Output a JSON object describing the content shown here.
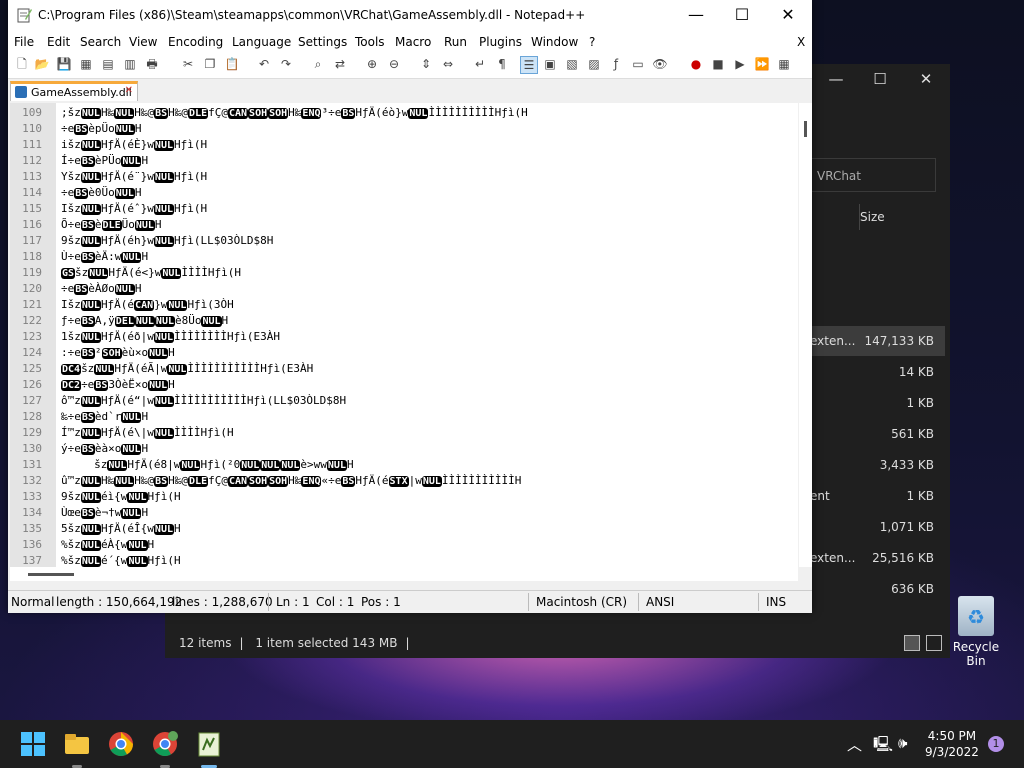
{
  "explorer": {
    "search_placeholder": "VRChat",
    "size_header": "Size",
    "rows": [
      {
        "name": "exten...",
        "size": "147,133 KB",
        "selected": true
      },
      {
        "name": "",
        "size": "14 KB"
      },
      {
        "name": "",
        "size": "1 KB"
      },
      {
        "name": "",
        "size": "561 KB"
      },
      {
        "name": "",
        "size": "3,433 KB"
      },
      {
        "name": "ent",
        "size": "1 KB"
      },
      {
        "name": "",
        "size": "1,071 KB"
      },
      {
        "name": "exten...",
        "size": "25,516 KB"
      },
      {
        "name": "",
        "size": "636 KB"
      }
    ],
    "status": {
      "items": "12 items",
      "selected": "1 item selected  143 MB"
    }
  },
  "npp": {
    "title": "C:\\Program Files (x86)\\Steam\\steamapps\\common\\VRChat\\GameAssembly.dll - Notepad++",
    "menu": [
      "File",
      "Edit",
      "Search",
      "View",
      "Encoding",
      "Language",
      "Settings",
      "Tools",
      "Macro",
      "Run",
      "Plugins",
      "Window",
      "?"
    ],
    "menu_close": "X",
    "tab_label": "GameAssembly.dll",
    "lines": [
      {
        "n": "109",
        "t": ";šz␀H‰␀H‰@␈H‰@␐fÇ@␘␁␁H‰␅³÷e␈HƒÄ(éò}w␀ÌÌÌÌÌÌÌÌÌÌHƒì(H"
      },
      {
        "n": "110",
        "t": "÷e␈èpÜo␀H"
      },
      {
        "n": "111",
        "t": "išz␀HƒÄ(éÈ}w␀Hƒì(H"
      },
      {
        "n": "112",
        "t": "Í÷e␈èPÜo␀H"
      },
      {
        "n": "113",
        "t": "Yšz␀HƒÄ(é¨}w␀Hƒì(H"
      },
      {
        "n": "114",
        "t": "÷e␈è0Üo␀H"
      },
      {
        "n": "115",
        "t": "Išz␀HƒÄ(éˆ}w␀Hƒì(H"
      },
      {
        "n": "116",
        "t": "Õ÷e␈è␐Üo␀H"
      },
      {
        "n": "117",
        "t": "9šz␀HƒÄ(éh}w␀Hƒì(LL$03ÒLD$8H"
      },
      {
        "n": "118",
        "t": "Ù÷e␈èÄ:w␀H"
      },
      {
        "n": "119",
        "t": "␝šz␀HƒÄ(é<}w␀ÌÌÌÌHƒì(H"
      },
      {
        "n": "120",
        "t": "÷e␈èÀØo␀H"
      },
      {
        "n": "121",
        "t": "Išz␀HƒÄ(é␘}w␀Hƒì(3ÒH"
      },
      {
        "n": "122",
        "t": "ƒ÷e␈A,ÿ␡␀␀è8Üo␀H"
      },
      {
        "n": "123",
        "t": "1šz␀HƒÄ(éð|w␀ÌÌÌÌÌÌÌÌHƒì(E3ÀH"
      },
      {
        "n": "124",
        "t": ":÷e␈²␁èù×o␀H"
      },
      {
        "n": "125",
        "t": "␔šz␀HƒÄ(éÃ|w␀ÌÌÌÌÌÌÌÌÌÌÌHƒì(E3ÀH"
      },
      {
        "n": "126",
        "t": "␒÷e␈3ÒèË×o␀H"
      },
      {
        "n": "127",
        "t": "ô™z␀HƒÄ(é“|w␀ÌÌÌÌÌÌÌÌÌÌÌHƒì(LL$03ÒLD$8H"
      },
      {
        "n": "128",
        "t": "‰÷e␈èd`r␀H"
      },
      {
        "n": "129",
        "t": "Í™z␀HƒÄ(é\\|w␀ÌÌÌÌHƒì(H"
      },
      {
        "n": "130",
        "t": "ý÷e␈èà×o␀H"
      },
      {
        "n": "131",
        "t": "     šz␀HƒÄ(é8|w␀Hƒì(²0␀␀␀è>ww␀H"
      },
      {
        "n": "132",
        "t": "û™z␀H‰␀H‰@␈H‰@␐fÇ@␘␁␁H‰␅«÷e␈HƒÄ(é␂|w␀ÌÌÌÌÌÌÌÌÌÌÌH"
      },
      {
        "n": "133",
        "t": "9šz␀éì{w␀Hƒì(H"
      },
      {
        "n": "134",
        "t": "Ùœe␈è¬†w␀H"
      },
      {
        "n": "135",
        "t": "5šz␀HƒÄ(éÎ{w␀H"
      },
      {
        "n": "136",
        "t": "%šz␀éÀ{w␀H"
      },
      {
        "n": "137",
        "t": "%šz␀é´{w␀Hƒì(H"
      }
    ],
    "status": {
      "type": "Normal",
      "length": "length : 150,664,192",
      "lines": "lines : 1,288,670",
      "ln": "Ln : 1",
      "col": "Col : 1",
      "pos": "Pos : 1",
      "eol": "Macintosh (CR)",
      "encoding": "ANSI",
      "mode": "INS"
    }
  },
  "desktop": {
    "recycle_label": "Recycle Bin"
  },
  "taskbar": {
    "time": "4:50 PM",
    "date": "9/3/2022",
    "notifications": "1"
  }
}
